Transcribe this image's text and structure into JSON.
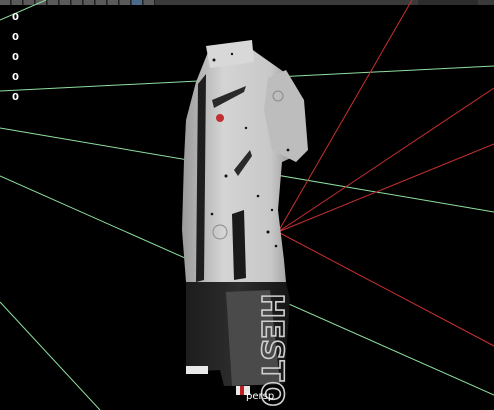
{
  "viewport": {
    "camera_label": "persp",
    "counters": [
      "0",
      "0",
      "0",
      "0",
      "0"
    ],
    "jersey_text": "HESTO",
    "colors": {
      "background": "#000000",
      "guide_green": "#8fe0a0",
      "guide_red": "#c83030"
    }
  }
}
